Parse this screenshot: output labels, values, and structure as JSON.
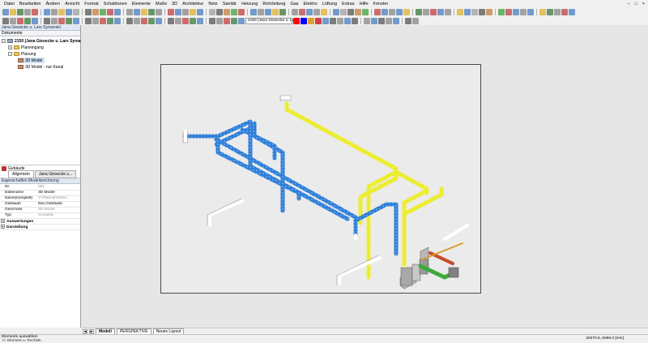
{
  "menu": {
    "items": [
      "Datei",
      "Bearbeiten",
      "Ändern",
      "Ansicht",
      "Format",
      "Schablonen",
      "Elemente",
      "Maße",
      "3D",
      "Architektur",
      "Netz",
      "Sanitär",
      "Heizung",
      "Rohrleitung",
      "Gas",
      "Elektro",
      "Lüftung",
      "Extras",
      "Hilfe",
      "Fenster"
    ],
    "window_controls": [
      "–",
      "□",
      "×"
    ]
  },
  "toolbar": {
    "project_combo": "2150 (Jana Giesecke u. La",
    "combo_icons": [
      "red",
      "blue",
      "#e0a030",
      "#d04040"
    ]
  },
  "left_panel": {
    "header": "Jana Giesecke u. Lars Symanski",
    "documents_header": "Dokumente",
    "tree": [
      {
        "label": "2150 (Jana Giesecke u. Lars Symanski)",
        "level": 0,
        "kind": "root"
      },
      {
        "label": "Planeingang",
        "level": 1,
        "kind": "folder"
      },
      {
        "label": "Planung",
        "level": 1,
        "kind": "folder"
      },
      {
        "label": "3D Model",
        "level": 2,
        "kind": "model",
        "selected": true
      },
      {
        "label": "3D Model - nur Kanal",
        "level": 2,
        "kind": "model"
      }
    ],
    "gebaeude_label": "Gebäude",
    "tabs": [
      "Allgemein",
      "Jana Giesecke u..."
    ],
    "properties_header": "Eigenschaften Modellzeichnung",
    "properties": [
      {
        "key": "Nr.",
        "value": "001",
        "grey": true
      },
      {
        "key": "Dateiname",
        "value": "3D Model",
        "grey": false
      },
      {
        "key": "Name(komplett)",
        "value": "Y:\\Plancal\\Schul...",
        "grey": true
      },
      {
        "key": "Gebäude",
        "value": "Neu Gebäude",
        "grey": false
      },
      {
        "key": "Geschoss",
        "value": "3D Model",
        "grey": true
      },
      {
        "key": "Typ",
        "value": "Grundriß",
        "grey": true
      }
    ],
    "groups": [
      "Auswertungen",
      "Darstellung"
    ]
  },
  "layout_tabs": [
    "Modell",
    "PERSPEKTIVE",
    "Neues Layout"
  ],
  "status": {
    "line1": "Elemente auswählen",
    "line2": "+/- Element u. Rechtsk.",
    "coords": "20270.8, 6068.2 [mm]"
  },
  "colors": {
    "heating_pipe": "#2e7fd8",
    "supply_pipe": "#ecec2c",
    "green_pipe": "#3caa3c",
    "red_pipe": "#c84a2a"
  }
}
